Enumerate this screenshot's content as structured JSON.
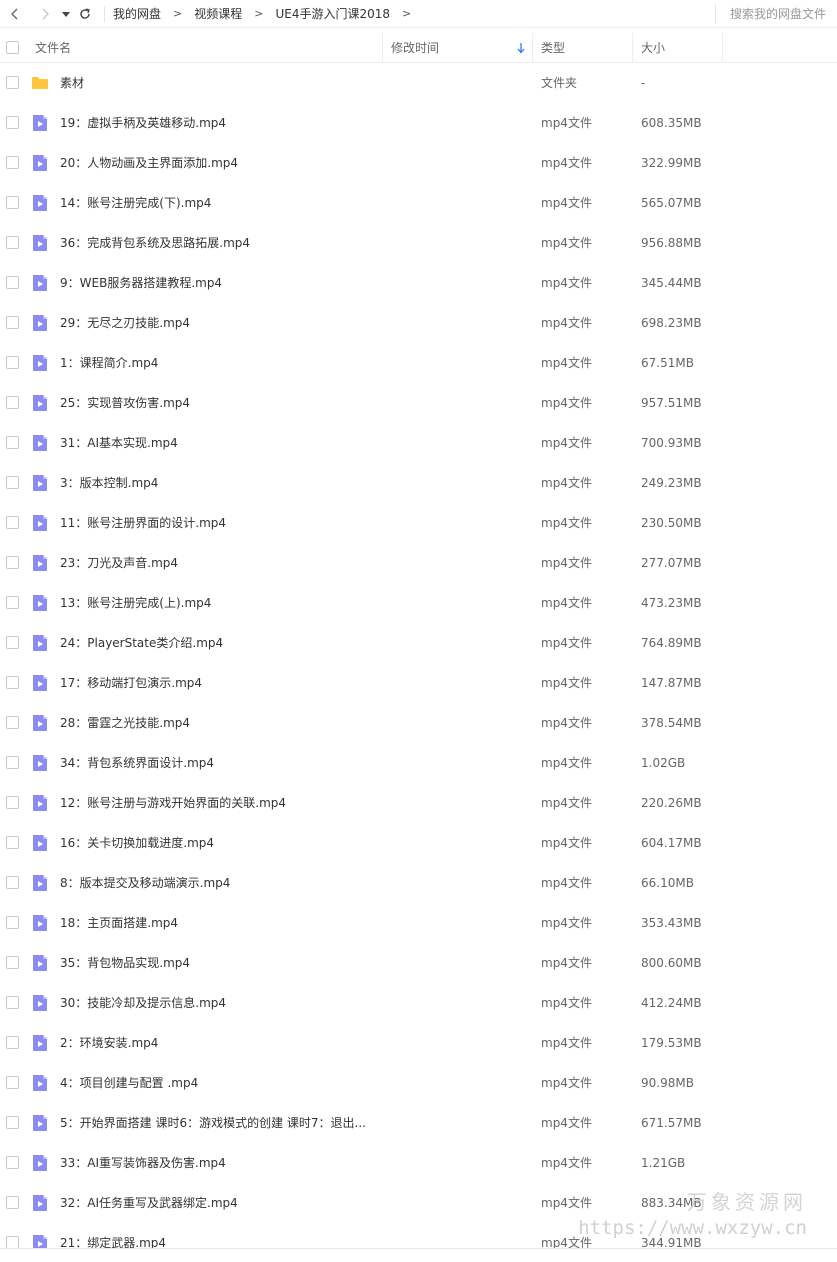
{
  "breadcrumb": {
    "items": [
      "我的网盘",
      "视频课程",
      "UE4手游入门课2018"
    ]
  },
  "search": {
    "placeholder": "搜索我的网盘文件"
  },
  "columns": {
    "name": "文件名",
    "modified": "修改时间",
    "type": "类型",
    "size": "大小"
  },
  "colors": {
    "folder": "#ffc53d",
    "video": "#8c8cf0",
    "sort_accent": "#2b7cf5"
  },
  "files": [
    {
      "kind": "folder",
      "name": "素材",
      "type": "文件夹",
      "size": "-"
    },
    {
      "kind": "video",
      "name": "19：虚拟手柄及英雄移动.mp4",
      "type": "mp4文件",
      "size": "608.35MB"
    },
    {
      "kind": "video",
      "name": "20：人物动画及主界面添加.mp4",
      "type": "mp4文件",
      "size": "322.99MB"
    },
    {
      "kind": "video",
      "name": "14：账号注册完成(下).mp4",
      "type": "mp4文件",
      "size": "565.07MB"
    },
    {
      "kind": "video",
      "name": "36：完成背包系统及思路拓展.mp4",
      "type": "mp4文件",
      "size": "956.88MB"
    },
    {
      "kind": "video",
      "name": "9：WEB服务器搭建教程.mp4",
      "type": "mp4文件",
      "size": "345.44MB"
    },
    {
      "kind": "video",
      "name": "29：无尽之刃技能.mp4",
      "type": "mp4文件",
      "size": "698.23MB"
    },
    {
      "kind": "video",
      "name": "1：课程简介.mp4",
      "type": "mp4文件",
      "size": "67.51MB"
    },
    {
      "kind": "video",
      "name": "25：实现普攻伤害.mp4",
      "type": "mp4文件",
      "size": "957.51MB"
    },
    {
      "kind": "video",
      "name": "31：AI基本实现.mp4",
      "type": "mp4文件",
      "size": "700.93MB"
    },
    {
      "kind": "video",
      "name": "3：版本控制.mp4",
      "type": "mp4文件",
      "size": "249.23MB"
    },
    {
      "kind": "video",
      "name": "11：账号注册界面的设计.mp4",
      "type": "mp4文件",
      "size": "230.50MB"
    },
    {
      "kind": "video",
      "name": "23：刀光及声音.mp4",
      "type": "mp4文件",
      "size": "277.07MB"
    },
    {
      "kind": "video",
      "name": "13：账号注册完成(上).mp4",
      "type": "mp4文件",
      "size": "473.23MB"
    },
    {
      "kind": "video",
      "name": "24：PlayerState类介绍.mp4",
      "type": "mp4文件",
      "size": "764.89MB"
    },
    {
      "kind": "video",
      "name": "17：移动端打包演示.mp4",
      "type": "mp4文件",
      "size": "147.87MB"
    },
    {
      "kind": "video",
      "name": "28：雷霆之光技能.mp4",
      "type": "mp4文件",
      "size": "378.54MB"
    },
    {
      "kind": "video",
      "name": "34：背包系统界面设计.mp4",
      "type": "mp4文件",
      "size": "1.02GB"
    },
    {
      "kind": "video",
      "name": "12：账号注册与游戏开始界面的关联.mp4",
      "type": "mp4文件",
      "size": "220.26MB"
    },
    {
      "kind": "video",
      "name": "16：关卡切换加载进度.mp4",
      "type": "mp4文件",
      "size": "604.17MB"
    },
    {
      "kind": "video",
      "name": "8：版本提交及移动端演示.mp4",
      "type": "mp4文件",
      "size": "66.10MB"
    },
    {
      "kind": "video",
      "name": "18：主页面搭建.mp4",
      "type": "mp4文件",
      "size": "353.43MB"
    },
    {
      "kind": "video",
      "name": "35：背包物品实现.mp4",
      "type": "mp4文件",
      "size": "800.60MB"
    },
    {
      "kind": "video",
      "name": "30：技能冷却及提示信息.mp4",
      "type": "mp4文件",
      "size": "412.24MB"
    },
    {
      "kind": "video",
      "name": "2：环境安装.mp4",
      "type": "mp4文件",
      "size": "179.53MB"
    },
    {
      "kind": "video",
      "name": "4：项目创建与配置 .mp4",
      "type": "mp4文件",
      "size": "90.98MB"
    },
    {
      "kind": "video",
      "name": "5：开始界面搭建 课时6：游戏模式的创建  课时7：退出...",
      "type": "mp4文件",
      "size": "671.57MB"
    },
    {
      "kind": "video",
      "name": "33：AI重写装饰器及伤害.mp4",
      "type": "mp4文件",
      "size": "1.21GB"
    },
    {
      "kind": "video",
      "name": "32：AI任务重写及武器绑定.mp4",
      "type": "mp4文件",
      "size": "883.34MB"
    },
    {
      "kind": "video",
      "name": "21：绑定武器.mp4",
      "type": "mp4文件",
      "size": "344.91MB"
    }
  ],
  "watermark": {
    "title": "万象资源网",
    "url": "https://www.wxzyw.cn"
  }
}
